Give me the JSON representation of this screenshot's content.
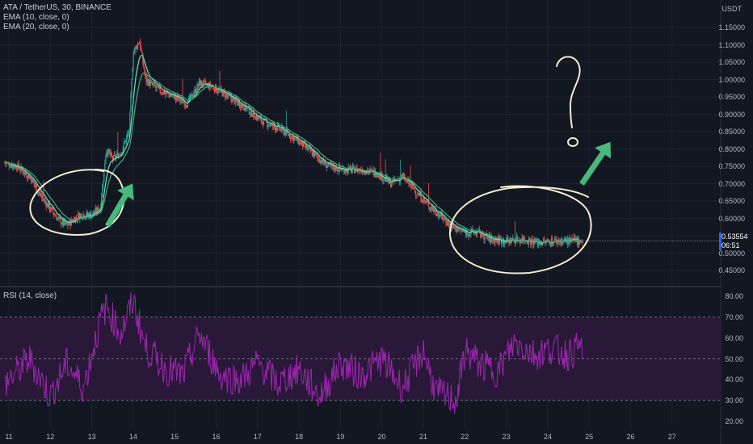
{
  "main_legend": {
    "symbol": "ATA / TetherUS, 30, BINANCE",
    "ema10": "EMA (10, close, 0)",
    "ema20": "EMA (20, close, 0)"
  },
  "rsi_legend": "RSI (14, close)",
  "price_axis": {
    "unit": "USDT",
    "ticks": [
      "1.15000",
      "1.10000",
      "1.05000",
      "1.00000",
      "0.95000",
      "0.90000",
      "0.85000",
      "0.80000",
      "0.75000",
      "0.70000",
      "0.65000",
      "0.60000",
      "0.55000",
      "0.50000",
      "0.45000"
    ],
    "current_price": "0.53554",
    "countdown": "06:51"
  },
  "rsi_axis": {
    "ticks": [
      "80.00",
      "70.00",
      "60.00",
      "50.00",
      "40.00",
      "30.00",
      "20.00"
    ]
  },
  "time_axis": {
    "ticks": [
      "11",
      "12",
      "13",
      "14",
      "15",
      "16",
      "17",
      "18",
      "19",
      "20",
      "21",
      "22",
      "23",
      "24",
      "25",
      "26",
      "27"
    ]
  },
  "colors": {
    "background": "#131722",
    "candle_up": "#26a69a",
    "candle_down": "#ef5350",
    "ema": "#5fcf9a",
    "rsi_line": "#9c27b0",
    "rsi_band": "#2a1838",
    "annotation": "#f2ecd0",
    "arrow": "#47b97d"
  },
  "chart_data": {
    "type": "candlestick",
    "price_range": [
      0.43,
      1.17
    ],
    "rsi_range": [
      17,
      83
    ],
    "close_keypoints": [
      [
        10.9,
        0.76
      ],
      [
        11.2,
        0.75
      ],
      [
        11.5,
        0.72
      ],
      [
        11.8,
        0.66
      ],
      [
        12.2,
        0.595
      ],
      [
        12.4,
        0.58
      ],
      [
        12.7,
        0.61
      ],
      [
        13.0,
        0.61
      ],
      [
        13.2,
        0.63
      ],
      [
        13.35,
        0.8
      ],
      [
        13.5,
        0.77
      ],
      [
        13.7,
        0.79
      ],
      [
        13.9,
        0.85
      ],
      [
        14.0,
        1.08
      ],
      [
        14.15,
        1.11
      ],
      [
        14.3,
        1.0
      ],
      [
        14.6,
        0.97
      ],
      [
        15.0,
        0.95
      ],
      [
        15.3,
        0.93
      ],
      [
        15.6,
        0.99
      ],
      [
        15.9,
        0.98
      ],
      [
        16.3,
        0.95
      ],
      [
        16.7,
        0.92
      ],
      [
        17.1,
        0.88
      ],
      [
        17.5,
        0.86
      ],
      [
        17.9,
        0.83
      ],
      [
        18.3,
        0.79
      ],
      [
        18.7,
        0.75
      ],
      [
        19.1,
        0.74
      ],
      [
        19.5,
        0.74
      ],
      [
        19.9,
        0.73
      ],
      [
        20.2,
        0.7
      ],
      [
        20.5,
        0.72
      ],
      [
        20.8,
        0.68
      ],
      [
        21.1,
        0.64
      ],
      [
        21.4,
        0.61
      ],
      [
        21.7,
        0.575
      ],
      [
        22.0,
        0.56
      ],
      [
        22.3,
        0.56
      ],
      [
        22.6,
        0.54
      ],
      [
        23.0,
        0.535
      ],
      [
        23.4,
        0.54
      ],
      [
        23.8,
        0.53
      ],
      [
        24.2,
        0.535
      ],
      [
        24.5,
        0.535
      ],
      [
        24.85,
        0.5355
      ]
    ],
    "rsi_keypoints": [
      [
        10.9,
        38
      ],
      [
        11.5,
        50
      ],
      [
        12.0,
        32
      ],
      [
        12.4,
        48
      ],
      [
        12.8,
        36
      ],
      [
        13.2,
        68
      ],
      [
        13.35,
        75
      ],
      [
        13.7,
        62
      ],
      [
        14.0,
        78
      ],
      [
        14.3,
        55
      ],
      [
        14.8,
        45
      ],
      [
        15.2,
        42
      ],
      [
        15.6,
        62
      ],
      [
        16.1,
        42
      ],
      [
        16.6,
        40
      ],
      [
        17.0,
        48
      ],
      [
        17.5,
        38
      ],
      [
        18.0,
        45
      ],
      [
        18.5,
        32
      ],
      [
        19.0,
        48
      ],
      [
        19.5,
        42
      ],
      [
        20.0,
        50
      ],
      [
        20.5,
        36
      ],
      [
        21.0,
        54
      ],
      [
        21.3,
        34
      ],
      [
        21.8,
        30
      ],
      [
        22.0,
        54
      ],
      [
        22.4,
        47
      ],
      [
        22.8,
        44
      ],
      [
        23.2,
        58
      ],
      [
        23.7,
        52
      ],
      [
        24.1,
        55
      ],
      [
        24.5,
        52
      ],
      [
        24.8,
        56
      ]
    ]
  }
}
